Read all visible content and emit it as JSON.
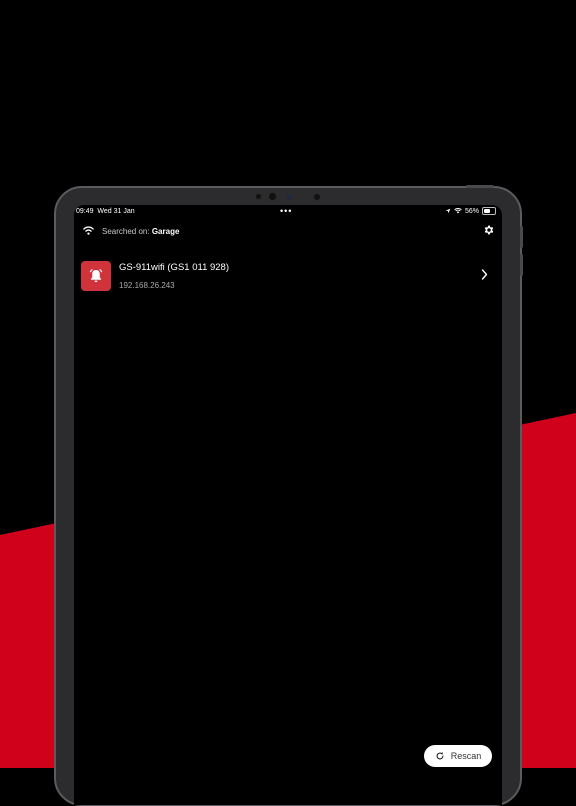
{
  "status_bar": {
    "time": "09:49",
    "date": "Wed 31 Jan",
    "dots": "•••",
    "battery": "56%",
    "battery_level": 0.56
  },
  "header": {
    "searched_label": "Searched on:",
    "network_name": "Garage"
  },
  "devices": [
    {
      "name": "GS-911wifi (GS1 011 928)",
      "ip": "192.168.26.243",
      "icon": "alarm-bell-icon"
    }
  ],
  "rescan_button": {
    "label": "Rescan",
    "icon": "refresh-icon"
  },
  "colors": {
    "brand_red": "#d0021b",
    "device_icon_red": "#d0333a",
    "background": "#000000"
  }
}
